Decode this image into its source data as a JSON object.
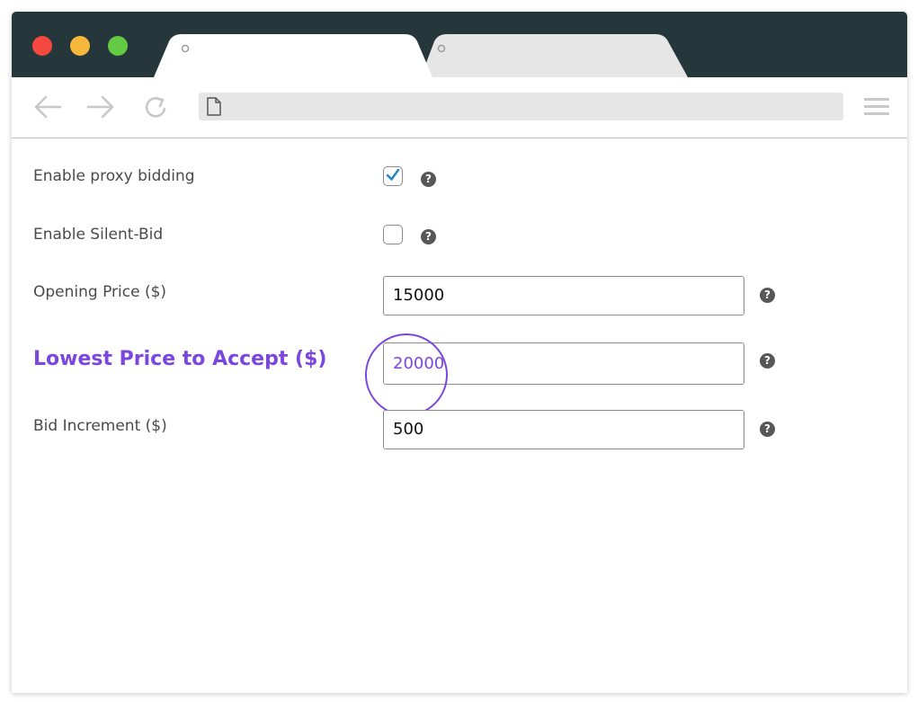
{
  "colors": {
    "titlebar": "#26373c",
    "accent": "#7b46de",
    "checkbox_check": "#2b86c6",
    "help_icon": "#575757"
  },
  "browser": {
    "traffic_lights": [
      "close-icon",
      "minimize-icon",
      "maximize-icon"
    ],
    "tabs": [
      {
        "label": "",
        "active": true
      },
      {
        "label": "",
        "active": false
      }
    ],
    "address": "",
    "nav_icons": [
      "back-arrow-icon",
      "forward-arrow-icon",
      "reload-icon"
    ],
    "menu_icon": "hamburger-menu-icon"
  },
  "settings": {
    "proxy_bidding": {
      "label": "Enable proxy bidding",
      "checked": true,
      "help": "?"
    },
    "silent_bid": {
      "label": "Enable Silent-Bid",
      "checked": false,
      "help": "?"
    },
    "opening_price": {
      "label": "Opening Price ($)",
      "value": "15000",
      "help": "?"
    },
    "lowest_price": {
      "label": "Lowest Price to Accept ($)",
      "value": "20000",
      "help": "?"
    },
    "bid_increment": {
      "label": "Bid Increment ($)",
      "value": "500",
      "help": "?"
    }
  }
}
